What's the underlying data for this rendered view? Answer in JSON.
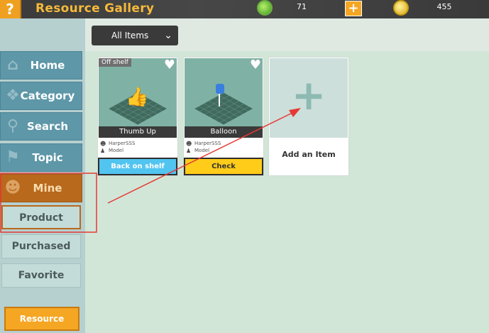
{
  "header": {
    "help_glyph": "?",
    "title": "Resource Gallery",
    "gems": "71",
    "coins": "455",
    "plus_glyph": "+"
  },
  "sidebar": {
    "items": [
      {
        "label": "Home",
        "icon": "home-icon"
      },
      {
        "label": "Category",
        "icon": "category-icon"
      },
      {
        "label": "Search",
        "icon": "search-icon"
      },
      {
        "label": "Topic",
        "icon": "topic-icon"
      },
      {
        "label": "Mine",
        "icon": "raccoon-icon"
      }
    ],
    "sub_items": [
      "Product",
      "Purchased",
      "Favorite"
    ],
    "resource_center": "Resource Center"
  },
  "main": {
    "filter_label": "All Items",
    "cards": [
      {
        "name": "Thumb Up",
        "tag": "Off shelf",
        "author": "HarperSSS",
        "type": "Model",
        "action": "Back on shelf"
      },
      {
        "name": "Balloon",
        "author": "HarperSSS",
        "type": "Model",
        "action": "Check"
      }
    ],
    "add_label": "Add an Item"
  },
  "colors": {
    "accent_orange": "#f5a623",
    "nav_blue": "#5d97a8",
    "mine_brown": "#b8691c",
    "annotation_red": "#e53935"
  }
}
